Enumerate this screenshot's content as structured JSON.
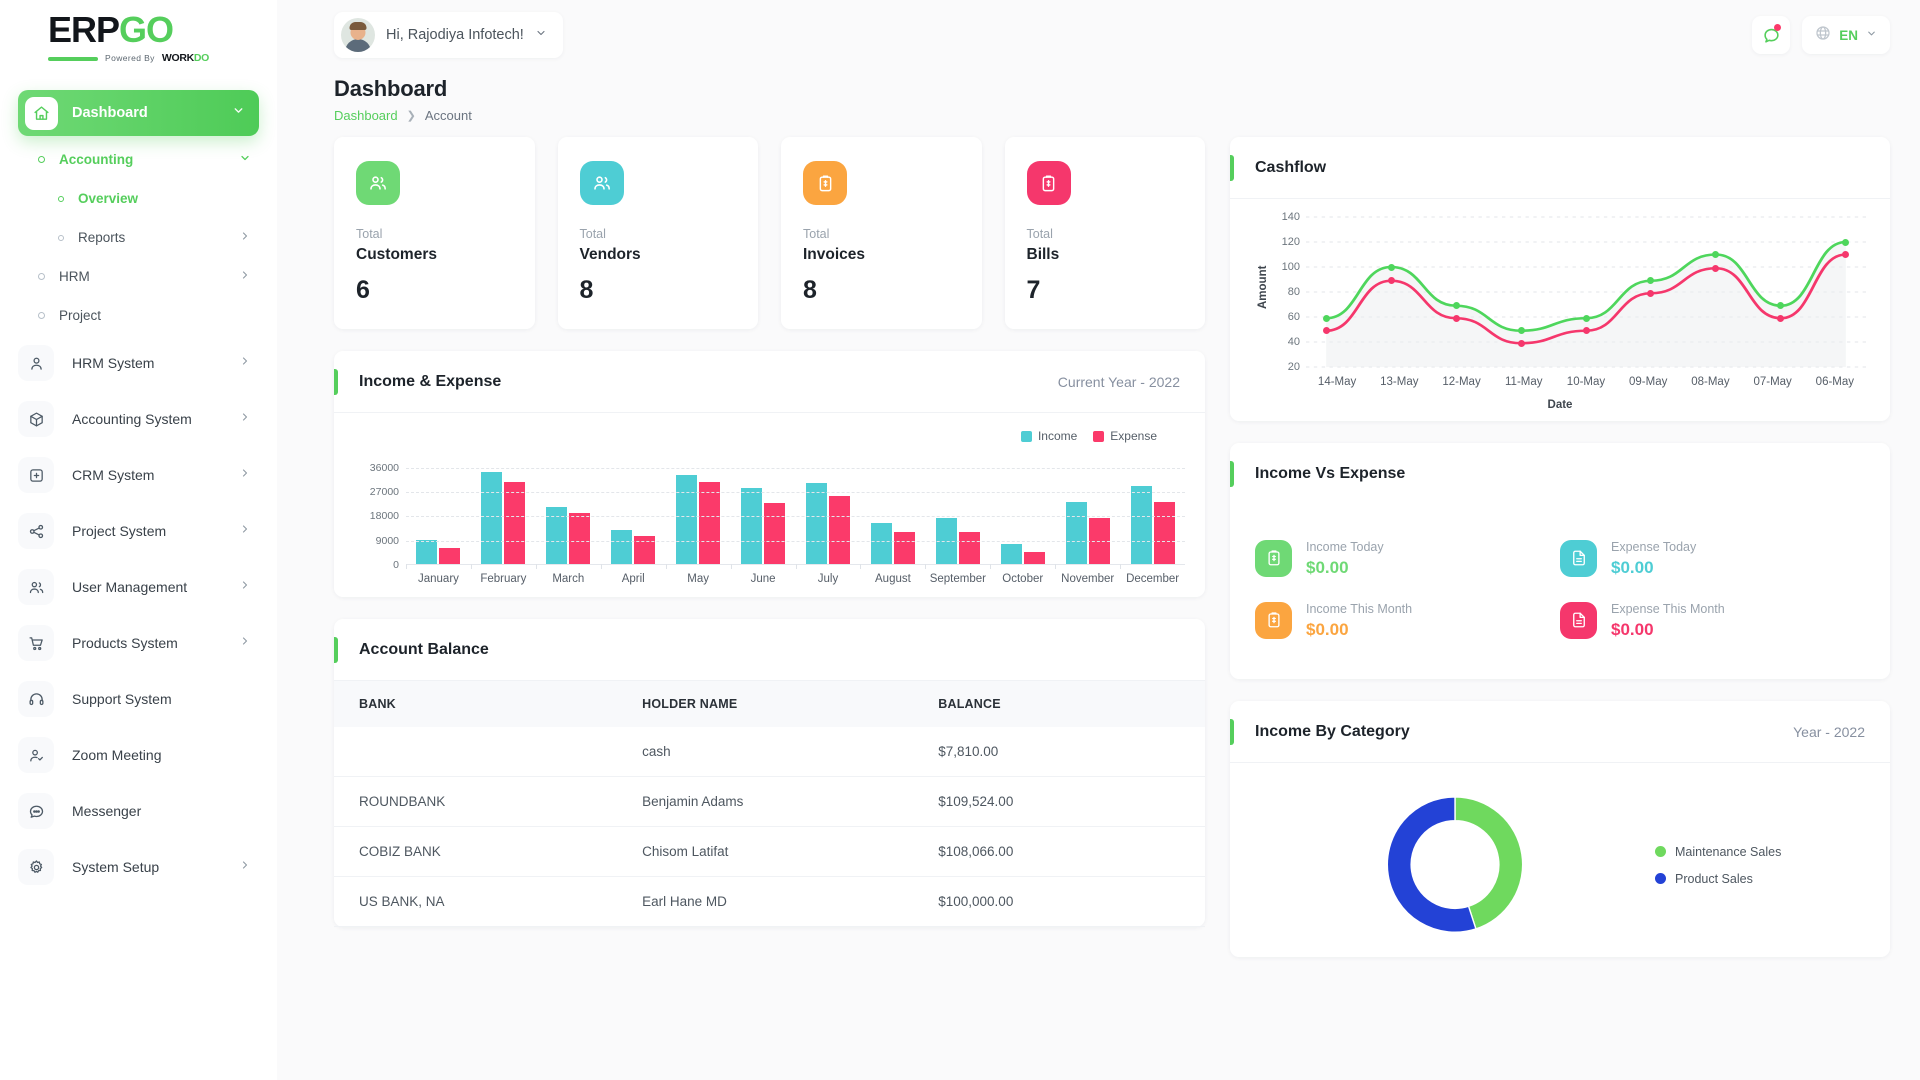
{
  "brand": {
    "name_dark": "ERP",
    "name_accent": "GO",
    "powered_by": "Powered By",
    "workdo_dark": "WORK",
    "workdo_accent": "DO",
    "accent_color": "#55ce5c"
  },
  "sidebar": {
    "main_item": {
      "label": "Dashboard",
      "icon": "home-icon"
    },
    "sub_items": [
      {
        "label": "Accounting",
        "level": 1,
        "active": true,
        "has_chevron": true,
        "chevron": "down"
      },
      {
        "label": "Overview",
        "level": 2,
        "active": true,
        "has_chevron": false
      },
      {
        "label": "Reports",
        "level": 2,
        "active": false,
        "has_chevron": true,
        "chevron": "right"
      },
      {
        "label": "HRM",
        "level": 1,
        "active": false,
        "has_chevron": true,
        "chevron": "right"
      },
      {
        "label": "Project",
        "level": 1,
        "active": false,
        "has_chevron": false
      }
    ],
    "items": [
      {
        "label": "HRM System",
        "icon": "user-icon",
        "chevron": true
      },
      {
        "label": "Accounting System",
        "icon": "box-icon",
        "chevron": true
      },
      {
        "label": "CRM System",
        "icon": "crm-icon",
        "chevron": true
      },
      {
        "label": "Project System",
        "icon": "share-icon",
        "chevron": true
      },
      {
        "label": "User Management",
        "icon": "users-icon",
        "chevron": true
      },
      {
        "label": "Products System",
        "icon": "cart-icon",
        "chevron": true
      },
      {
        "label": "Support System",
        "icon": "headset-icon",
        "chevron": false
      },
      {
        "label": "Zoom Meeting",
        "icon": "user-check-icon",
        "chevron": false
      },
      {
        "label": "Messenger",
        "icon": "chat-icon",
        "chevron": false
      },
      {
        "label": "System Setup",
        "icon": "gear-icon",
        "chevron": true
      }
    ]
  },
  "topbar": {
    "greeting": "Hi, Rajodiya Infotech!",
    "language": "EN",
    "notification_icon": "chat-notification-icon",
    "globe_icon": "globe-icon"
  },
  "page": {
    "title": "Dashboard",
    "breadcrumb": [
      "Dashboard",
      "Account"
    ]
  },
  "stats": [
    {
      "prefix": "Total",
      "label": "Customers",
      "value": "6",
      "color": "#6fd975",
      "icon": "customers-icon"
    },
    {
      "prefix": "Total",
      "label": "Vendors",
      "value": "8",
      "color": "#4ecdd4",
      "icon": "vendors-icon"
    },
    {
      "prefix": "Total",
      "label": "Invoices",
      "value": "8",
      "color": "#fba540",
      "icon": "invoice-icon"
    },
    {
      "prefix": "Total",
      "label": "Bills",
      "value": "7",
      "color": "#f5376c",
      "icon": "bill-icon"
    }
  ],
  "income_expense": {
    "title": "Income & Expense",
    "period": "Current Year - 2022"
  },
  "account_balance": {
    "title": "Account Balance",
    "columns": [
      "BANK",
      "HOLDER NAME",
      "BALANCE"
    ],
    "rows": [
      {
        "bank": "",
        "holder": "cash",
        "balance": "$7,810.00"
      },
      {
        "bank": "ROUNDBANK",
        "holder": "Benjamin Adams",
        "balance": "$109,524.00"
      },
      {
        "bank": "COBIZ BANK",
        "holder": "Chisom Latifat",
        "balance": "$108,066.00"
      },
      {
        "bank": "US BANK, NA",
        "holder": "Earl Hane MD",
        "balance": "$100,000.00"
      }
    ]
  },
  "cashflow": {
    "title": "Cashflow"
  },
  "income_vs_expense": {
    "title": "Income Vs Expense",
    "items": [
      {
        "label": "Income Today",
        "value": "$0.00",
        "color": "#6fd975",
        "icon": "income-clipboard-icon"
      },
      {
        "label": "Expense Today",
        "value": "$0.00",
        "color": "#4ecdd4",
        "icon": "expense-file-icon"
      },
      {
        "label": "Income This Month",
        "value": "$0.00",
        "color": "#fba540",
        "icon": "income-clipboard-icon"
      },
      {
        "label": "Expense This Month",
        "value": "$0.00",
        "color": "#f5376c",
        "icon": "expense-file-icon"
      }
    ]
  },
  "income_by_category": {
    "title": "Income By Category",
    "period": "Year - 2022"
  },
  "chart_data": [
    {
      "id": "income_expense_bar",
      "type": "bar",
      "title": "Income & Expense",
      "subtitle": "Current Year - 2022",
      "xlabel": "",
      "ylabel": "",
      "ylim": [
        0,
        40000
      ],
      "yticks": [
        0,
        9000,
        18000,
        27000,
        36000
      ],
      "grid": true,
      "legend_position": "top-right",
      "categories": [
        "January",
        "February",
        "March",
        "April",
        "May",
        "June",
        "July",
        "August",
        "September",
        "October",
        "November",
        "December"
      ],
      "series": [
        {
          "name": "Income",
          "color": "#4ecdd4",
          "values": [
            8800,
            34000,
            21000,
            12500,
            33000,
            28000,
            30000,
            15000,
            17000,
            7500,
            23000,
            29000
          ]
        },
        {
          "name": "Expense",
          "color": "#fb3a6a",
          "values": [
            5800,
            30500,
            19000,
            10500,
            30500,
            22500,
            25000,
            12000,
            12000,
            4500,
            17000,
            23000
          ]
        }
      ]
    },
    {
      "id": "cashflow_line",
      "type": "line",
      "title": "Cashflow",
      "xlabel": "Date",
      "ylabel": "Amount",
      "ylim": [
        20,
        140
      ],
      "yticks": [
        20,
        40,
        60,
        80,
        100,
        120,
        140
      ],
      "grid": true,
      "x": [
        "14-May",
        "13-May",
        "12-May",
        "11-May",
        "10-May",
        "09-May",
        "08-May",
        "07-May",
        "06-May"
      ],
      "series": [
        {
          "name": "Income",
          "color": "#4ed65c",
          "values": [
            59,
            100,
            69,
            49,
            59,
            89,
            110,
            69,
            120
          ]
        },
        {
          "name": "Expense",
          "color": "#f5376c",
          "values": [
            49,
            89,
            59,
            39,
            49,
            79,
            99,
            59,
            110
          ]
        }
      ]
    },
    {
      "id": "income_by_category_donut",
      "type": "pie",
      "title": "Income By Category",
      "subtitle": "Year - 2022",
      "legend_position": "right",
      "labels": [
        "Maintenance Sales",
        "Product Sales"
      ],
      "values": [
        45,
        55
      ],
      "colors": [
        "#6fd95e",
        "#2342d6"
      ]
    }
  ]
}
